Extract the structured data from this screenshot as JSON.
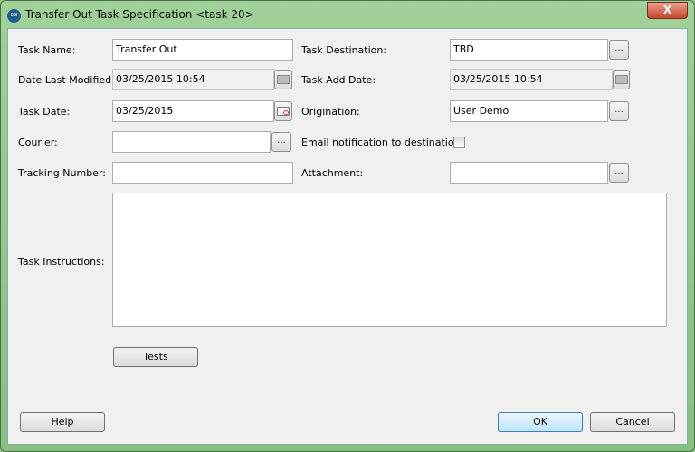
{
  "window": {
    "title": "Transfer Out Task Specification <task 20>",
    "icon_text": "BSI",
    "close": "X"
  },
  "form": {
    "task_name": {
      "label": "Task Name:",
      "value": "Transfer Out"
    },
    "date_last_modified": {
      "label": "Date Last Modified:",
      "value": "03/25/2015 10:54"
    },
    "task_date": {
      "label": "Task Date:",
      "value": "03/25/2015"
    },
    "courier": {
      "label": "Courier:",
      "value": ""
    },
    "tracking_number": {
      "label": "Tracking Number:",
      "value": ""
    },
    "task_destination": {
      "label": "Task Destination:",
      "value": "TBD"
    },
    "task_add_date": {
      "label": "Task Add Date:",
      "value": "03/25/2015 10:54"
    },
    "origination": {
      "label": "Origination:",
      "value": "User Demo"
    },
    "email_notification": {
      "label": "Email notification to destination:",
      "checked": false
    },
    "attachment": {
      "label": "Attachment:",
      "value": ""
    },
    "task_instructions": {
      "label": "Task Instructions:",
      "value": ""
    },
    "browse": "..."
  },
  "buttons": {
    "tests": "Tests",
    "help": "Help",
    "ok": "OK",
    "cancel": "Cancel"
  }
}
